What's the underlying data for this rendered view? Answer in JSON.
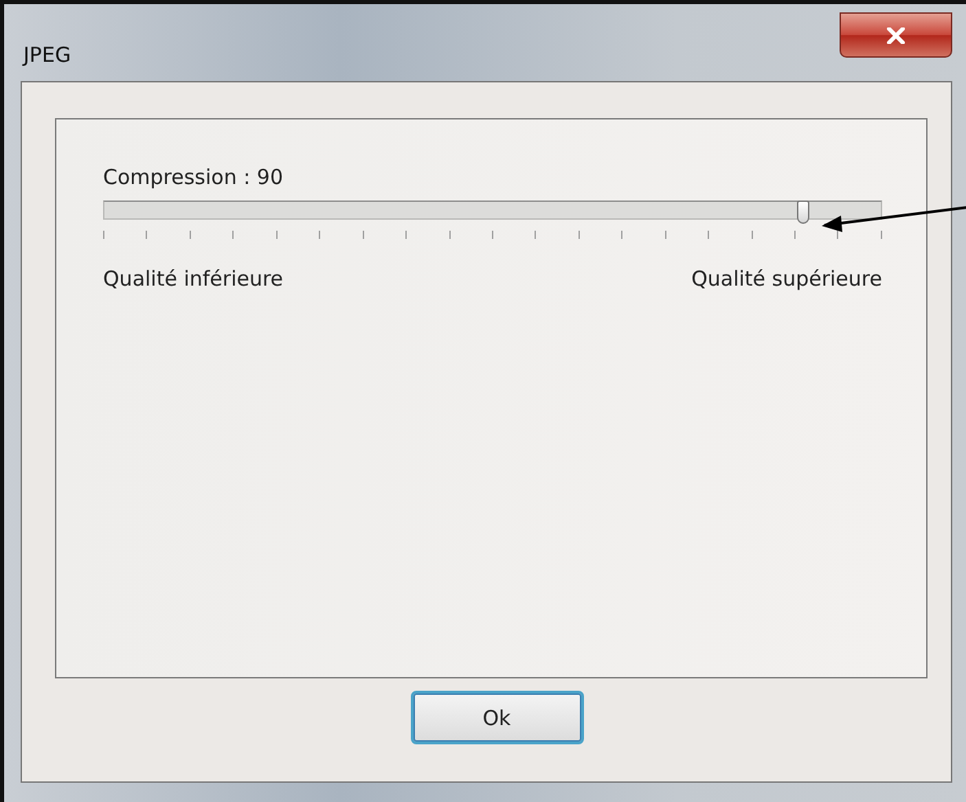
{
  "window": {
    "title": "JPEG"
  },
  "slider": {
    "label": "Compression : 90",
    "level": 0.9,
    "min_label": "Qualité inférieure",
    "max_label": "Qualité supérieure"
  },
  "buttons": [
    {
      "label": "Ok",
      "kind": "default"
    }
  ]
}
